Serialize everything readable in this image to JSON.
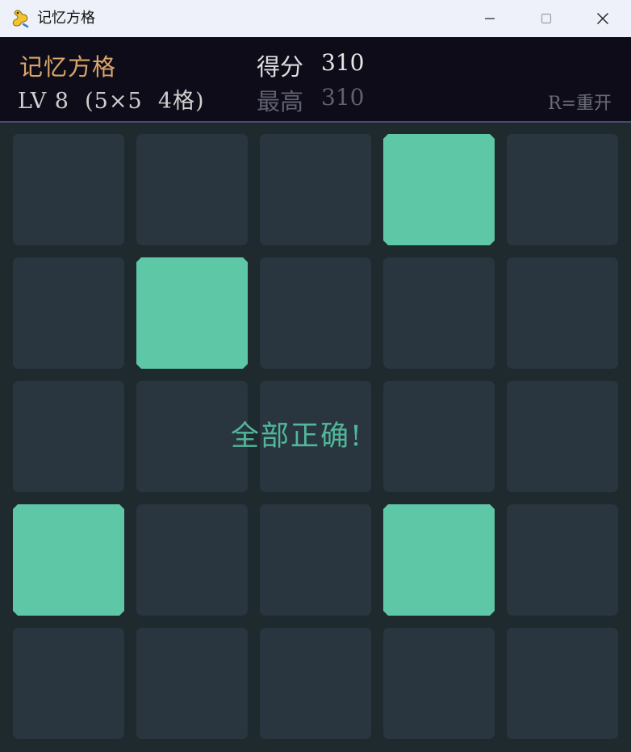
{
  "window": {
    "title": "记忆方格",
    "minimize_icon": "minimize-icon",
    "maximize_icon": "maximize-icon",
    "close_icon": "close-icon"
  },
  "header": {
    "game_title": "记忆方格",
    "level_info": "LV 8  (5×5  4格)",
    "score_label": "得分",
    "score_value": "310",
    "best_label": "最高",
    "best_value": "310",
    "restart_hint": "R=重开"
  },
  "board": {
    "rows": 5,
    "cols": 5,
    "lit_cells": [
      [
        0,
        3
      ],
      [
        1,
        1
      ],
      [
        3,
        0
      ],
      [
        3,
        3
      ]
    ],
    "message": "全部正确!"
  },
  "colors": {
    "lit": "#5ec8a6",
    "unlit": "#29353f",
    "background": "#1f2a2f",
    "header_bg": "#0f0c19",
    "title_accent": "#d9a56a",
    "message": "#52b79a"
  }
}
